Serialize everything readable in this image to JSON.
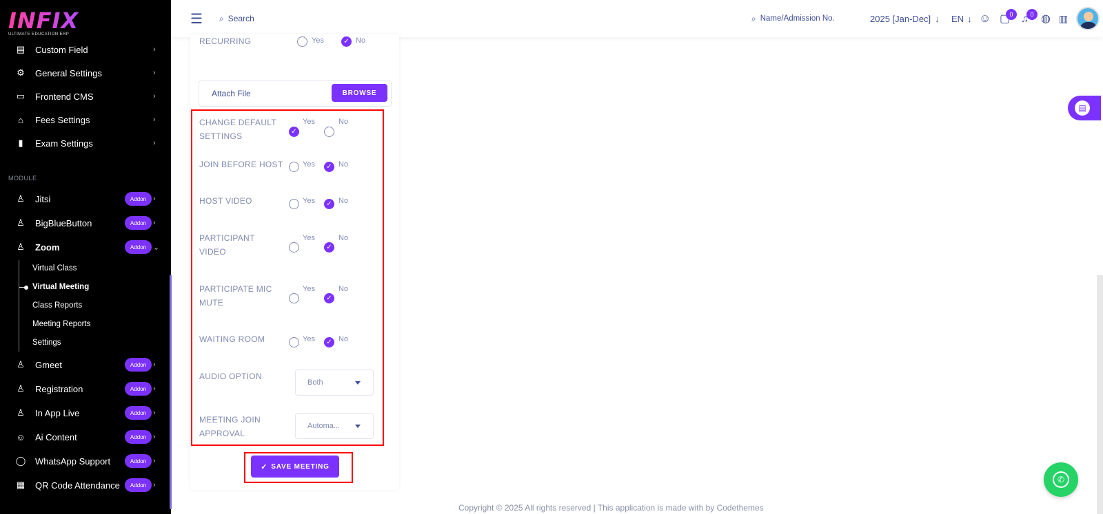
{
  "brand": {
    "logo_text": "INFIX",
    "tagline": "ULTIMATE EDUCATION ERP"
  },
  "sidebar": {
    "items_top": [
      {
        "label": "Custom Field",
        "icon": "custom-field-icon"
      },
      {
        "label": "General Settings",
        "icon": "gears-icon"
      },
      {
        "label": "Frontend CMS",
        "icon": "monitor-icon"
      },
      {
        "label": "Fees Settings",
        "icon": "bank-icon"
      },
      {
        "label": "Exam Settings",
        "icon": "book-icon"
      }
    ],
    "section_label": "MODULE",
    "addon_label": "Addon",
    "modules": [
      {
        "label": "Jitsi",
        "icon": "video-user-icon"
      },
      {
        "label": "BigBlueButton",
        "icon": "video-user-icon"
      },
      {
        "label": "Zoom",
        "icon": "video-user-icon"
      },
      {
        "label": "Gmeet",
        "icon": "video-user-icon"
      },
      {
        "label": "Registration",
        "icon": "video-user-icon"
      },
      {
        "label": "In App Live",
        "icon": "video-user-icon"
      },
      {
        "label": "Ai Content",
        "icon": "robot-icon"
      },
      {
        "label": "WhatsApp Support",
        "icon": "whatsapp-icon"
      },
      {
        "label": "QR Code Attendance",
        "icon": "qr-code-icon"
      }
    ],
    "zoom_submenu": [
      "Virtual Class",
      "Virtual Meeting",
      "Class Reports",
      "Meeting Reports",
      "Settings"
    ],
    "active_submenu": "Virtual Meeting"
  },
  "topbar": {
    "search_label": "Search",
    "student_search_placeholder": "Name/Admission No.",
    "session": "2025 [Jan-Dec]",
    "language": "EN",
    "chat_count": "0",
    "notification_count": "0"
  },
  "form": {
    "recurring": {
      "label": "RECURRING",
      "yes": "Yes",
      "no": "No",
      "selected": "No"
    },
    "attach_file": {
      "label": "Attach File",
      "button": "BROWSE"
    },
    "settings": [
      {
        "label_lines": [
          "CHANGE DEFAULT",
          "SETTINGS"
        ],
        "yes": "Yes",
        "no": "No",
        "selected": "Yes"
      },
      {
        "label_lines": [
          "JOIN BEFORE HOST"
        ],
        "yes": "Yes",
        "no": "No",
        "selected": "No"
      },
      {
        "label_lines": [
          "HOST VIDEO"
        ],
        "yes": "Yes",
        "no": "No",
        "selected": "No"
      },
      {
        "label_lines": [
          "PARTICIPANT",
          "VIDEO"
        ],
        "yes": "Yes",
        "no": "No",
        "selected": "No"
      },
      {
        "label_lines": [
          "PARTICIPATE MIC",
          "MUTE"
        ],
        "yes": "Yes",
        "no": "No",
        "selected": "No"
      },
      {
        "label_lines": [
          "WAITING ROOM"
        ],
        "yes": "Yes",
        "no": "No",
        "selected": "No"
      }
    ],
    "audio_option": {
      "label": "AUDIO OPTION",
      "value": "Both"
    },
    "meeting_join_approval": {
      "label_lines": [
        "MEETING JOIN",
        "APPROVAL"
      ],
      "value": "Automa..."
    },
    "save_button": "SAVE MEETING",
    "save_check": "✓"
  },
  "footer": {
    "copyright": "Copyright © 2025 All rights reserved | This application is made with by Codethemes"
  },
  "colors": {
    "accent": "#7c32ff",
    "highlight": "#ff0000",
    "whatsapp": "#25d366",
    "sidebar_bg": "#000000"
  }
}
